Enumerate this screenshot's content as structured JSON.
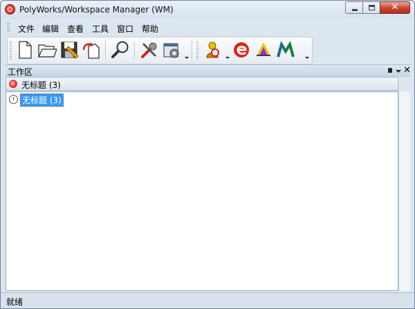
{
  "window": {
    "title": "PolyWorks/Workspace Manager (WM)",
    "icon": "polyworks-logo-icon"
  },
  "menu": [
    "文件",
    "编辑",
    "查看",
    "工具",
    "窗口",
    "帮助"
  ],
  "toolbar": {
    "buttons": [
      {
        "name": "new-file-icon"
      },
      {
        "name": "open-folder-icon"
      },
      {
        "name": "save-icon"
      },
      {
        "name": "import-icon"
      },
      {
        "name": "find-icon"
      },
      {
        "name": "tools-icon"
      },
      {
        "name": "settings-icon"
      },
      {
        "name": "inspector-icon"
      },
      {
        "name": "edit-module-icon"
      },
      {
        "name": "feature-module-icon"
      },
      {
        "name": "modeler-module-icon"
      }
    ]
  },
  "panel": {
    "title": "工作区",
    "tab_label": "无标题 (3)",
    "tree_item": "无标题 (3)"
  },
  "status": {
    "text": "就绪"
  },
  "colors": {
    "accent": "#d7261b",
    "selection": "#3399ff",
    "frame": "#dce6ef"
  }
}
